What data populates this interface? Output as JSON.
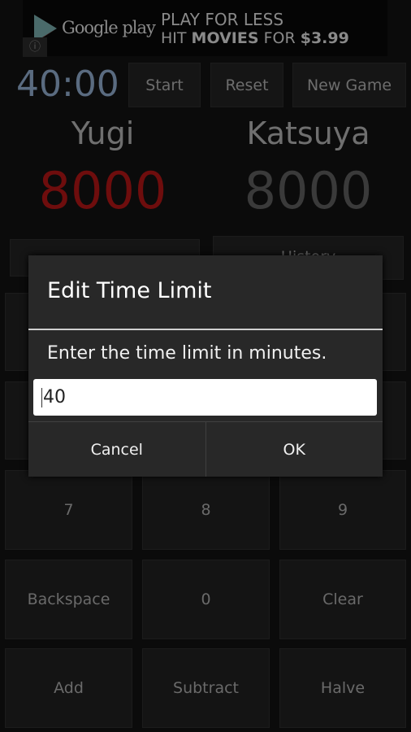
{
  "ad": {
    "brand": "Google play",
    "line1": "PLAY FOR LESS",
    "line2_a": "HIT ",
    "line2_b": "MOVIES",
    "line2_c": " FOR ",
    "line2_d": "$3.99",
    "info_icon": "ⓘ"
  },
  "header": {
    "timer": "40:00",
    "start": "Start",
    "reset": "Reset",
    "new_game": "New Game"
  },
  "players": [
    {
      "name": "Yugi",
      "life": "8000",
      "color": "#6e0d0d"
    },
    {
      "name": "Katsuya",
      "life": "8000",
      "color": "#3a3a3a"
    }
  ],
  "history_label": "History",
  "keypad": {
    "rows": [
      [
        "7",
        "8",
        "9"
      ],
      [
        "Backspace",
        "0",
        "Clear"
      ],
      [
        "Add",
        "Subtract",
        "Halve"
      ]
    ]
  },
  "dialog": {
    "title": "Edit Time Limit",
    "message": "Enter the time limit in minutes.",
    "value": "40",
    "cancel": "Cancel",
    "ok": "OK"
  }
}
